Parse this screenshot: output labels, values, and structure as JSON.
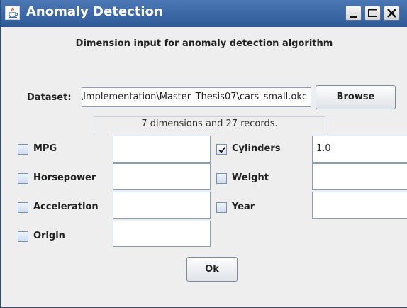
{
  "window": {
    "title": "Anomaly Detection",
    "app_icon": "java-cup-icon",
    "controls": [
      "minimize-icon",
      "maximize-icon",
      "close-icon"
    ]
  },
  "heading": "Dimension input for anomaly detection algorithm",
  "dataset": {
    "label": "Dataset:",
    "value": "...\\Implementation\\Master_Thesis07\\cars_small.okc",
    "browse_label": "Browse"
  },
  "info": "7 dimensions and 27 records.",
  "dimensions": [
    {
      "label": "MPG",
      "checked": false,
      "value": ""
    },
    {
      "label": "Cylinders",
      "checked": true,
      "value": "1.0"
    },
    {
      "label": "Horsepower",
      "checked": false,
      "value": ""
    },
    {
      "label": "Weight",
      "checked": false,
      "value": ""
    },
    {
      "label": "Acceleration",
      "checked": false,
      "value": ""
    },
    {
      "label": "Year",
      "checked": false,
      "value": ""
    },
    {
      "label": "Origin",
      "checked": false,
      "value": ""
    }
  ],
  "ok_label": "Ok",
  "colors": {
    "title_bar": "#3b67a6",
    "background": "#eeeeee",
    "field_border": "#8a9db5"
  }
}
